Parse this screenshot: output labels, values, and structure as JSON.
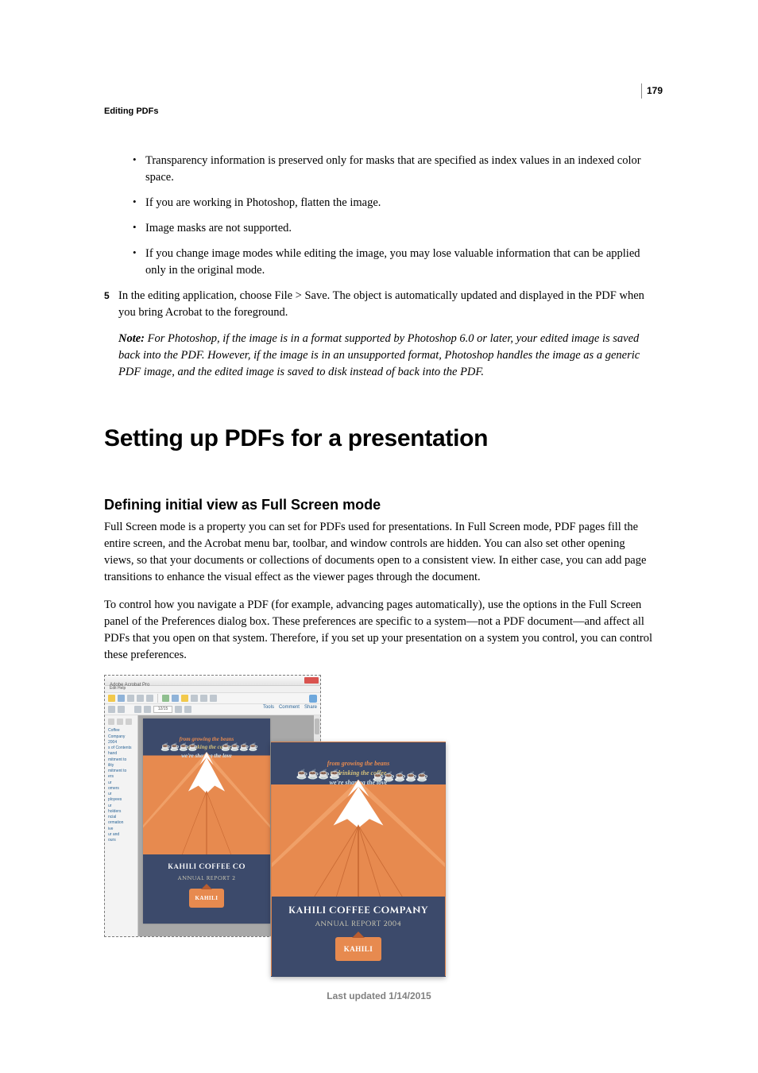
{
  "page_number": "179",
  "running_header": "Editing PDFs",
  "bullets": [
    "Transparency information is preserved only for masks that are specified as index values in an indexed color space.",
    "If you are working in Photoshop, flatten the image.",
    "Image masks are not supported.",
    "If you change image modes while editing the image, you may lose valuable information that can be applied only in the original mode."
  ],
  "step5": {
    "num": "5",
    "text": "In the editing application, choose File > Save. The object is automatically updated and displayed in the PDF when you bring Acrobat to the foreground.",
    "note_label": "Note:",
    "note_text": " For Photoshop, if the image is in a format supported by Photoshop 6.0 or later, your edited image is saved back into the PDF. However, if the image is in an unsupported format, Photoshop handles the image as a generic PDF image, and the edited image is saved to disk instead of back into the PDF."
  },
  "h1": "Setting up PDFs for a presentation",
  "h2": "Defining initial view as Full Screen mode",
  "para1": "Full Screen mode is a property you can set for PDFs used for presentations. In Full Screen mode, PDF pages fill the entire screen, and the Acrobat menu bar, toolbar, and window controls are hidden. You can also set other opening views, so that your documents or collections of documents open to a consistent view. In either case, you can add page transitions to enhance the visual effect as the viewer pages through the document.",
  "para2": "To control how you navigate a PDF (for example, advancing pages automatically), use the options in the Full Screen panel of the Preferences dialog box. These preferences are specific to a system—not a PDF document—and affect all PDFs that you open on that system. Therefore, if you set up your presentation on a system you control, you can control these preferences.",
  "acrobat": {
    "title": "Adobe Acrobat Pro",
    "menubar": "Edit   Help",
    "nav_value": "12/15",
    "tools": "Tools",
    "comment": "Comment",
    "share": "Share",
    "bookmarks": [
      "Coffee",
      "Company",
      "2004",
      "s of Contents",
      "hand",
      "mitment to",
      "ility",
      "mitment to",
      "ers",
      "ur",
      "omers",
      "ur",
      "ployees",
      "ur",
      "holders",
      "ncial",
      "ormation",
      "ive",
      "ur and",
      "ours"
    ]
  },
  "cover": {
    "sky1": "from growing the beans",
    "sky2": "to drinking the coffee",
    "sky3": "we're sharing the love",
    "beans": "☕☕☕☕",
    "beans2": "☕☕☕☕☕",
    "company": "KAHILI COFFEE COMPANY",
    "company_trunc": "KAHILI COFFEE CO",
    "report": "ANNUAL REPORT 2004",
    "report_trunc": "ANNUAL REPORT 2",
    "badge": "KAHILI"
  },
  "footer": "Last updated 1/14/2015"
}
